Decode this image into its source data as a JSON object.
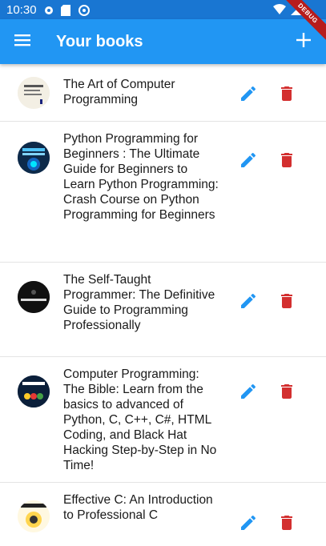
{
  "status_bar": {
    "time": "10:30",
    "debug_label": "DEBUG"
  },
  "app_bar": {
    "title": "Your books",
    "menu_icon": "hamburger-menu-icon",
    "add_icon": "plus-icon"
  },
  "colors": {
    "primary": "#2196F3",
    "primary_dark": "#1976D2",
    "edit": "#2196F3",
    "delete": "#D32F2F"
  },
  "books": [
    {
      "title": "The Art of Computer Programming",
      "cover_text": "The Art of Computer Programming"
    },
    {
      "title": "Python Programming for Beginners : The Ultimate Guide for Beginners to Learn Python Programming: Crash Course on Python Programming for Beginners",
      "cover_text": "PYTHON PROGRAMMING"
    },
    {
      "title": "The Self-Taught Programmer: The Definitive Guide to Programming Professionally",
      "cover_text": "PROGRAMMER"
    },
    {
      "title": "Computer Programming: The Bible: Learn from the basics to advanced of Python, C, C++, C#, HTML Coding, and Black Hat Hacking Step-by-Step in No Time!",
      "cover_text": "PROGRAMMING"
    },
    {
      "title": "Effective C: An Introduction to Professional C",
      "cover_text": "EFFECTIVE C"
    }
  ]
}
